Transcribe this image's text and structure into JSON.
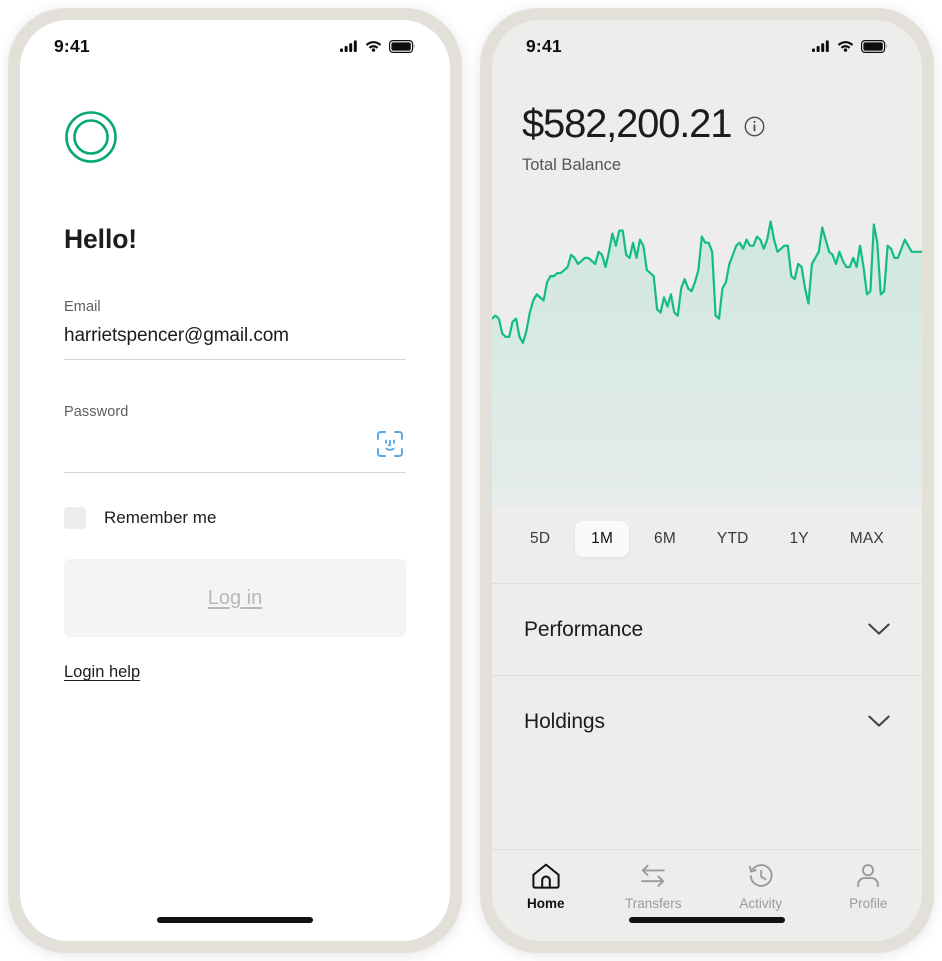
{
  "colors": {
    "brand_green": "#07a86c",
    "chart_line": "#12bd84",
    "chart_fill_top": "#cfe7de",
    "chart_fill_bottom": "#e3ece8",
    "phone_frame": "#e3e0da",
    "right_screen_bg": "#ededeb",
    "faceid_blue": "#56a8e8",
    "accent_text": "#1c1c1c"
  },
  "status_bar": {
    "time": "9:41",
    "cellular_icon": "signal-bars-icon",
    "wifi_icon": "wifi-icon",
    "battery_icon": "battery-full-icon"
  },
  "login": {
    "logo_icon": "concentric-rings-logo",
    "greeting": "Hello!",
    "email": {
      "label": "Email",
      "value": "harrietspencer@gmail.com",
      "placeholder": "Email"
    },
    "password": {
      "label": "Password",
      "value": "",
      "placeholder": "",
      "faceid_icon": "face-id-icon"
    },
    "remember_me": {
      "label": "Remember me",
      "checked": false
    },
    "submit_label": "Log in",
    "help_label": "Login help"
  },
  "portfolio": {
    "balance_amount": "$582,200.21",
    "balance_caption": "Total Balance",
    "info_icon": "info-circle-icon",
    "ranges": [
      {
        "label": "5D",
        "active": false
      },
      {
        "label": "1M",
        "active": true
      },
      {
        "label": "6M",
        "active": false
      },
      {
        "label": "YTD",
        "active": false
      },
      {
        "label": "1Y",
        "active": false
      },
      {
        "label": "MAX",
        "active": false
      }
    ],
    "sections": [
      {
        "title": "Performance",
        "chevron_icon": "chevron-down-icon"
      },
      {
        "title": "Holdings",
        "chevron_icon": "chevron-down-icon"
      }
    ],
    "tabs": [
      {
        "label": "Home",
        "icon": "home-icon",
        "active": true
      },
      {
        "label": "Transfers",
        "icon": "transfer-arrows-icon",
        "active": false
      },
      {
        "label": "Activity",
        "icon": "clock-history-icon",
        "active": false
      },
      {
        "label": "Profile",
        "icon": "person-icon",
        "active": false
      }
    ]
  },
  "chart_data": {
    "type": "area",
    "title": "Total Balance",
    "xlabel": "",
    "ylabel": "",
    "grid": false,
    "legend": "none",
    "range_selected": "1M",
    "ylim": [
      0,
      100
    ],
    "y_note": "values are normalized 0-100 of plot height; line occupies the upper ~35% of the panel",
    "values": [
      62,
      63,
      62,
      57,
      56,
      56,
      61,
      62,
      56,
      54,
      58,
      64,
      68,
      70,
      69,
      68,
      74,
      76,
      76,
      77,
      77,
      78,
      79,
      83,
      82,
      80,
      81,
      82,
      82,
      81,
      80,
      84,
      83,
      79,
      84,
      90,
      86,
      91,
      91,
      83,
      82,
      87,
      82,
      88,
      86,
      78,
      77,
      76,
      65,
      64,
      69,
      66,
      70,
      64,
      63,
      72,
      75,
      72,
      71,
      74,
      78,
      89,
      87,
      87,
      84,
      63,
      62,
      72,
      74,
      80,
      83,
      86,
      87,
      85,
      88,
      86,
      86,
      89,
      88,
      85,
      88,
      94,
      88,
      84,
      85,
      86,
      86,
      76,
      75,
      80,
      79,
      72,
      67,
      80,
      82,
      84,
      92,
      88,
      84,
      83,
      80,
      84,
      81,
      79,
      79,
      82,
      79,
      86,
      79,
      70,
      71,
      93,
      87,
      70,
      71,
      86,
      85,
      82,
      82,
      85,
      88,
      86,
      84,
      84,
      84,
      84
    ]
  }
}
